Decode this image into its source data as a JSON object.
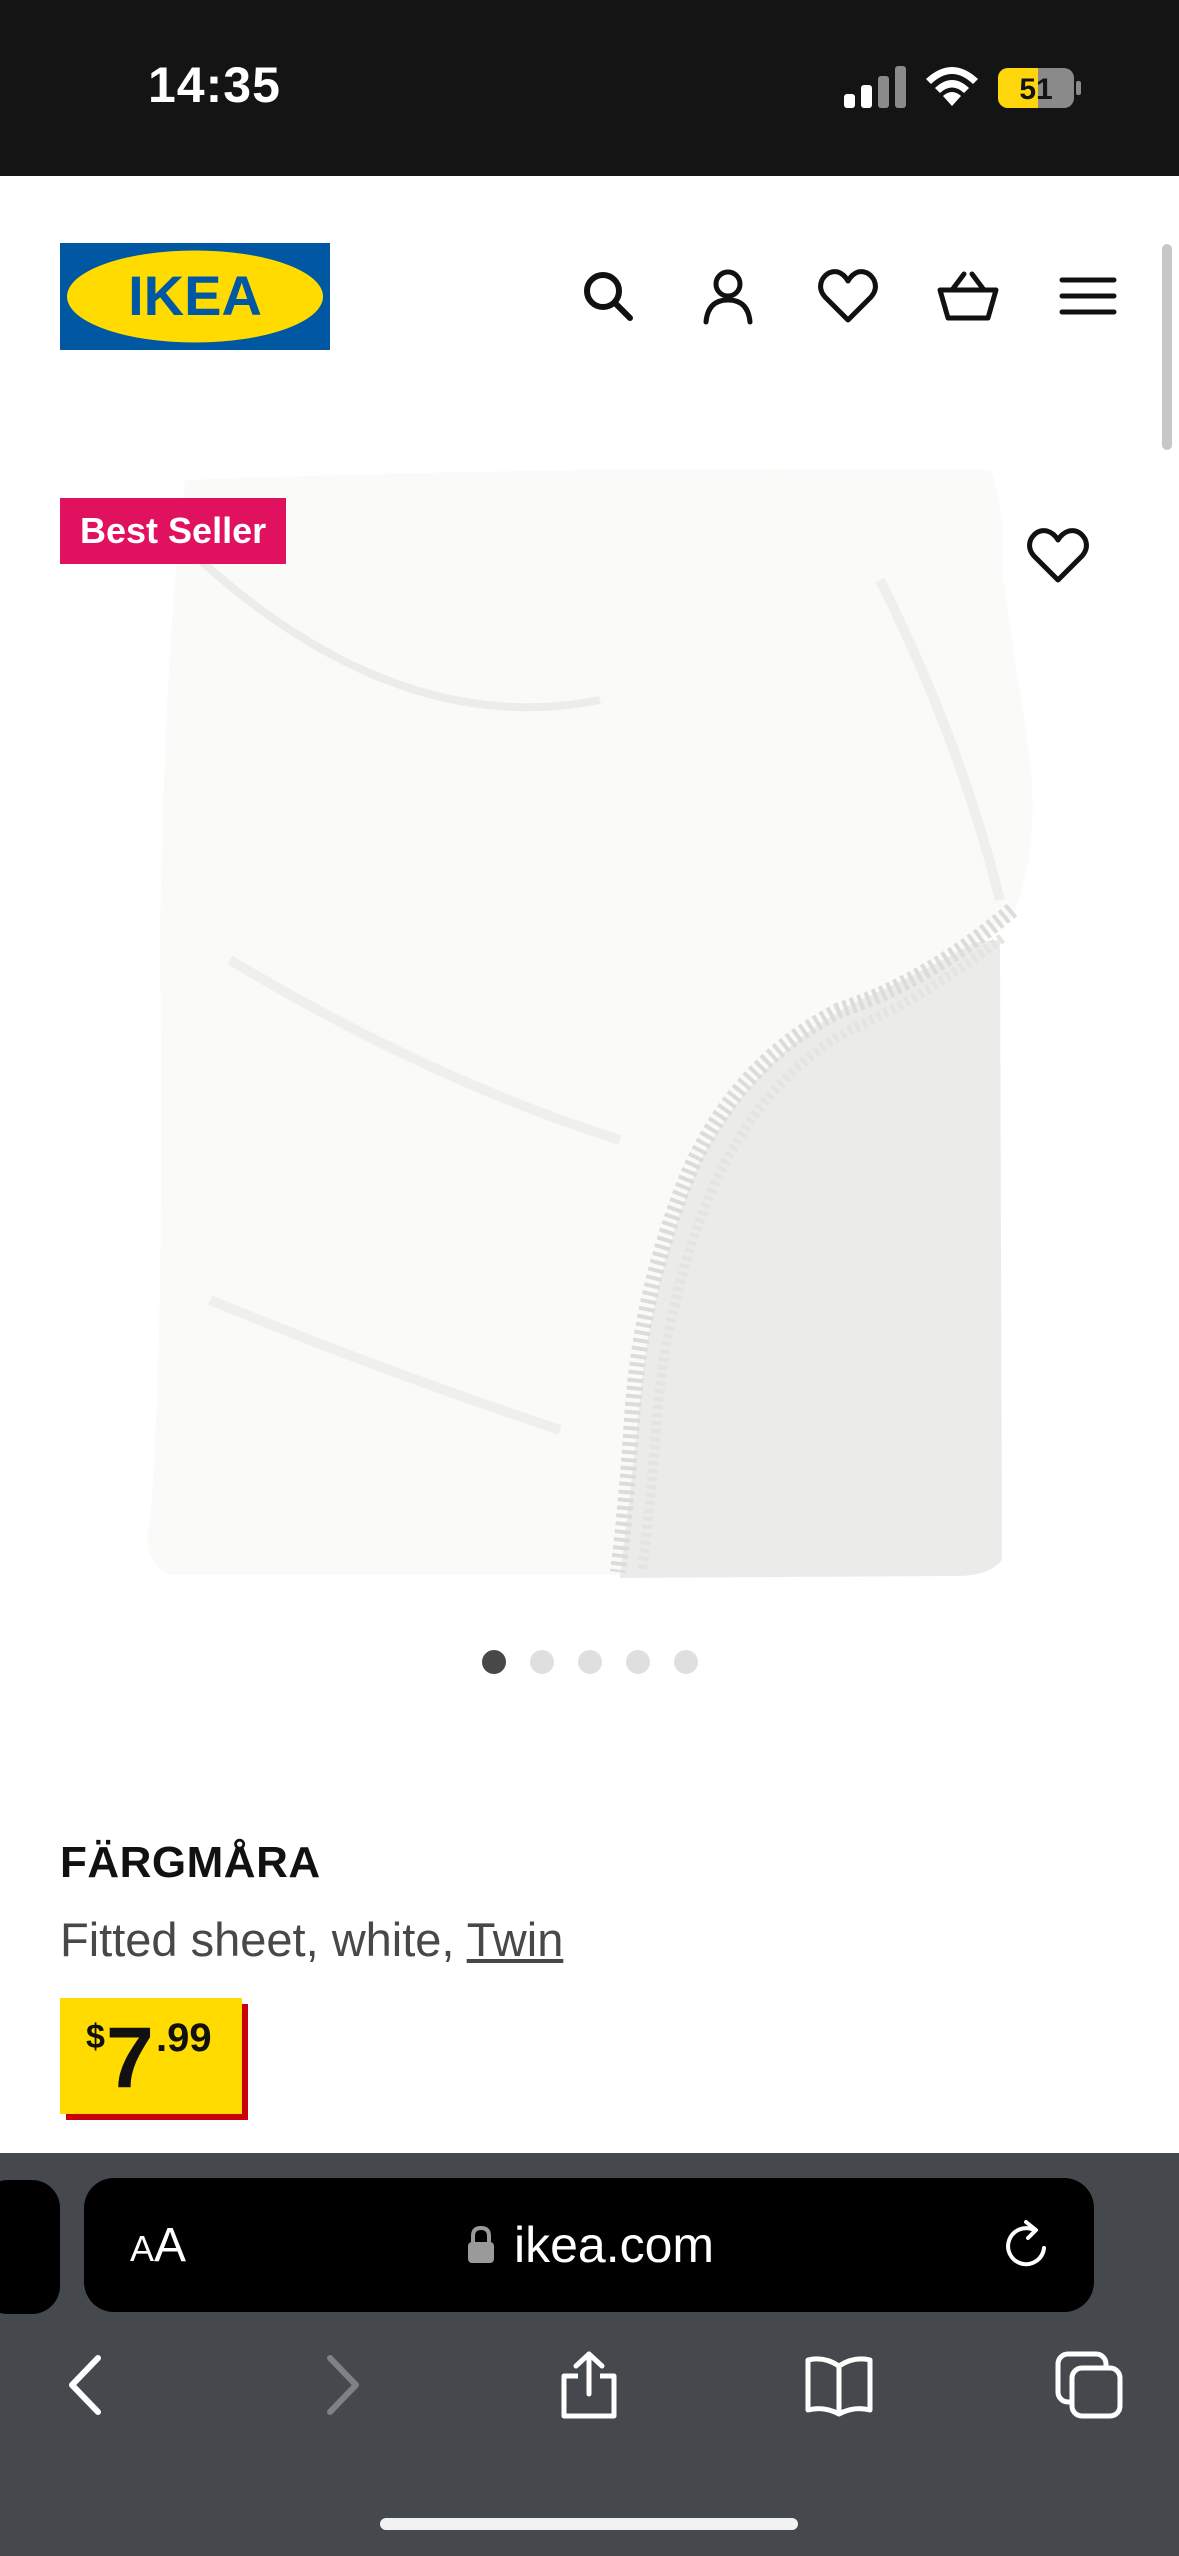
{
  "status_bar": {
    "time": "14:35",
    "battery_level": "51",
    "icons": [
      "cellular-signal-icon",
      "wifi-icon",
      "battery-icon"
    ]
  },
  "header": {
    "logo_text": "IKEA",
    "logo_colors": {
      "background": "#0058a3",
      "oval": "#ffdb00",
      "text": "#0058a3"
    },
    "icons": [
      "search-icon",
      "account-icon",
      "heart-icon",
      "cart-icon",
      "menu-icon"
    ]
  },
  "product": {
    "badge": "Best Seller",
    "badge_color": "#e0115f",
    "name": "FÄRGMÅRA",
    "description_prefix": "Fitted sheet, white, ",
    "size_link": "Twin",
    "price": {
      "currency": "$",
      "integer": "7",
      "decimal": ".99"
    },
    "price_colors": {
      "background": "#ffdb00",
      "shadow": "#cc0008"
    },
    "image_icon": "fitted-sheet-image",
    "carousel": {
      "total": 5,
      "active": 1
    }
  },
  "browser": {
    "text_size_label_small": "A",
    "text_size_label_large": "A",
    "url": "ikea.com",
    "toolbar_icons": [
      "back-icon",
      "forward-icon",
      "share-icon",
      "bookmarks-icon",
      "tabs-icon"
    ]
  }
}
